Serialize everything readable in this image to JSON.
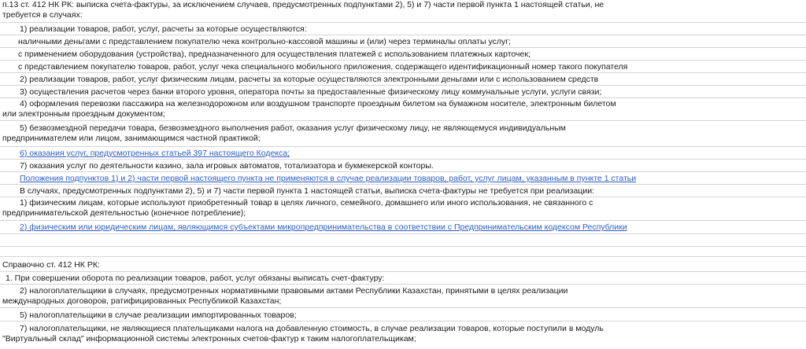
{
  "section1": {
    "header_line1": "п.13 ст. 412 НК РК: выписка счета-фактуры, за исключением случаев, предусмотренных подпунктами 2), 5) и 7) части первой пункта 1 настоящей статьи, не",
    "header_line2": "требуется в случаях:",
    "item1": "1) реализации товаров, работ, услуг, расчеты за которые осуществляются:",
    "item1a": "наличными деньгами с представлением покупателю чека контрольно-кассовой машины и (или) через терминалы оплаты услуг;",
    "item1b": "с применением оборудования (устройства), предназначенного для осуществления платежей с использованием платежных карточек;",
    "item1c": "с представлением покупателю товаров, работ, услуг чека специального мобильного приложения, содержащего идентификационный номер такого покупателя",
    "item2": "2) реализации товаров, работ, услуг физическим лицам, расчеты за которые осуществляются электронными деньгами или с использованием средств",
    "item3": "3) осуществления расчетов через банки второго уровня, оператора почты за предоставленные физическому лицу коммунальные услуги, услуги связи;",
    "item4_line1": "4) оформления перевозки пассажира на железнодорожном или воздушном транспорте проездным билетом на бумажном носителе, электронным билетом",
    "item4_line2": "или электронным проездным документом;",
    "item5_line1": "5) безвозмездной передачи товара, безвозмездного выполнения работ, оказания услуг физическому лицу, не являющемуся индивидуальным",
    "item5_line2": "предпринимателем или лицом, занимающимся частной практикой;",
    "item6": "6) оказания услуг, предусмотренных статьей 397 настоящего Кодекса;",
    "item7": "7) оказания услуг по деятельности казино, зала игровых автоматов, тотализатора и букмекерской конторы.",
    "provisions": "Положения подпунктов 1) и 2) части первой настоящего пункта не применяются в случае реализации товаров, работ, услуг лицам, указанным в пункте 1 статьи",
    "cases": "В случаях, предусмотренных подпунктами 2), 5) и 7) части первой пункта 1 настоящей статьи, выписка счета-фактуры не требуется при реализации:",
    "sub1_line1": "1) физическим лицам, которые используют приобретенный товар в целях личного, семейного, домашнего или иного использования, не связанного с",
    "sub1_line2": "предпринимательской деятельностью (конечное потребление);",
    "sub2": "2) физическим или юридическим лицам, являющимся субъектами микропредпринимательства в соответствии с Предпринимательским кодексом Республики"
  },
  "section2": {
    "header": "Справочно ст. 412 НК РК:",
    "item1": "1. При совершении оборота по реализации товаров, работ, услуг обязаны выписать счет-фактуру:",
    "item2_line1": "2) налогоплательщики в случаях, предусмотренных нормативными правовыми актами Республики Казахстан, принятыми в целях реализации",
    "item2_line2": "международных договоров, ратифицированных Республикой Казахстан;",
    "item5": "5) налогоплательщики в случае реализации импортированных товаров;",
    "item7_line1": "7) налогоплательщики, не являющиеся плательщиками налога на добавленную стоимость, в случае реализации товаров, которые поступили в модуль",
    "item7_line2": "\"Виртуальный склад\" информационной системы электронных счетов-фактур к таким налогоплательщикам;"
  },
  "colors": {
    "text": "#1a1a1a",
    "link": "#2e5fc2",
    "grid": "#d4d4d4"
  }
}
